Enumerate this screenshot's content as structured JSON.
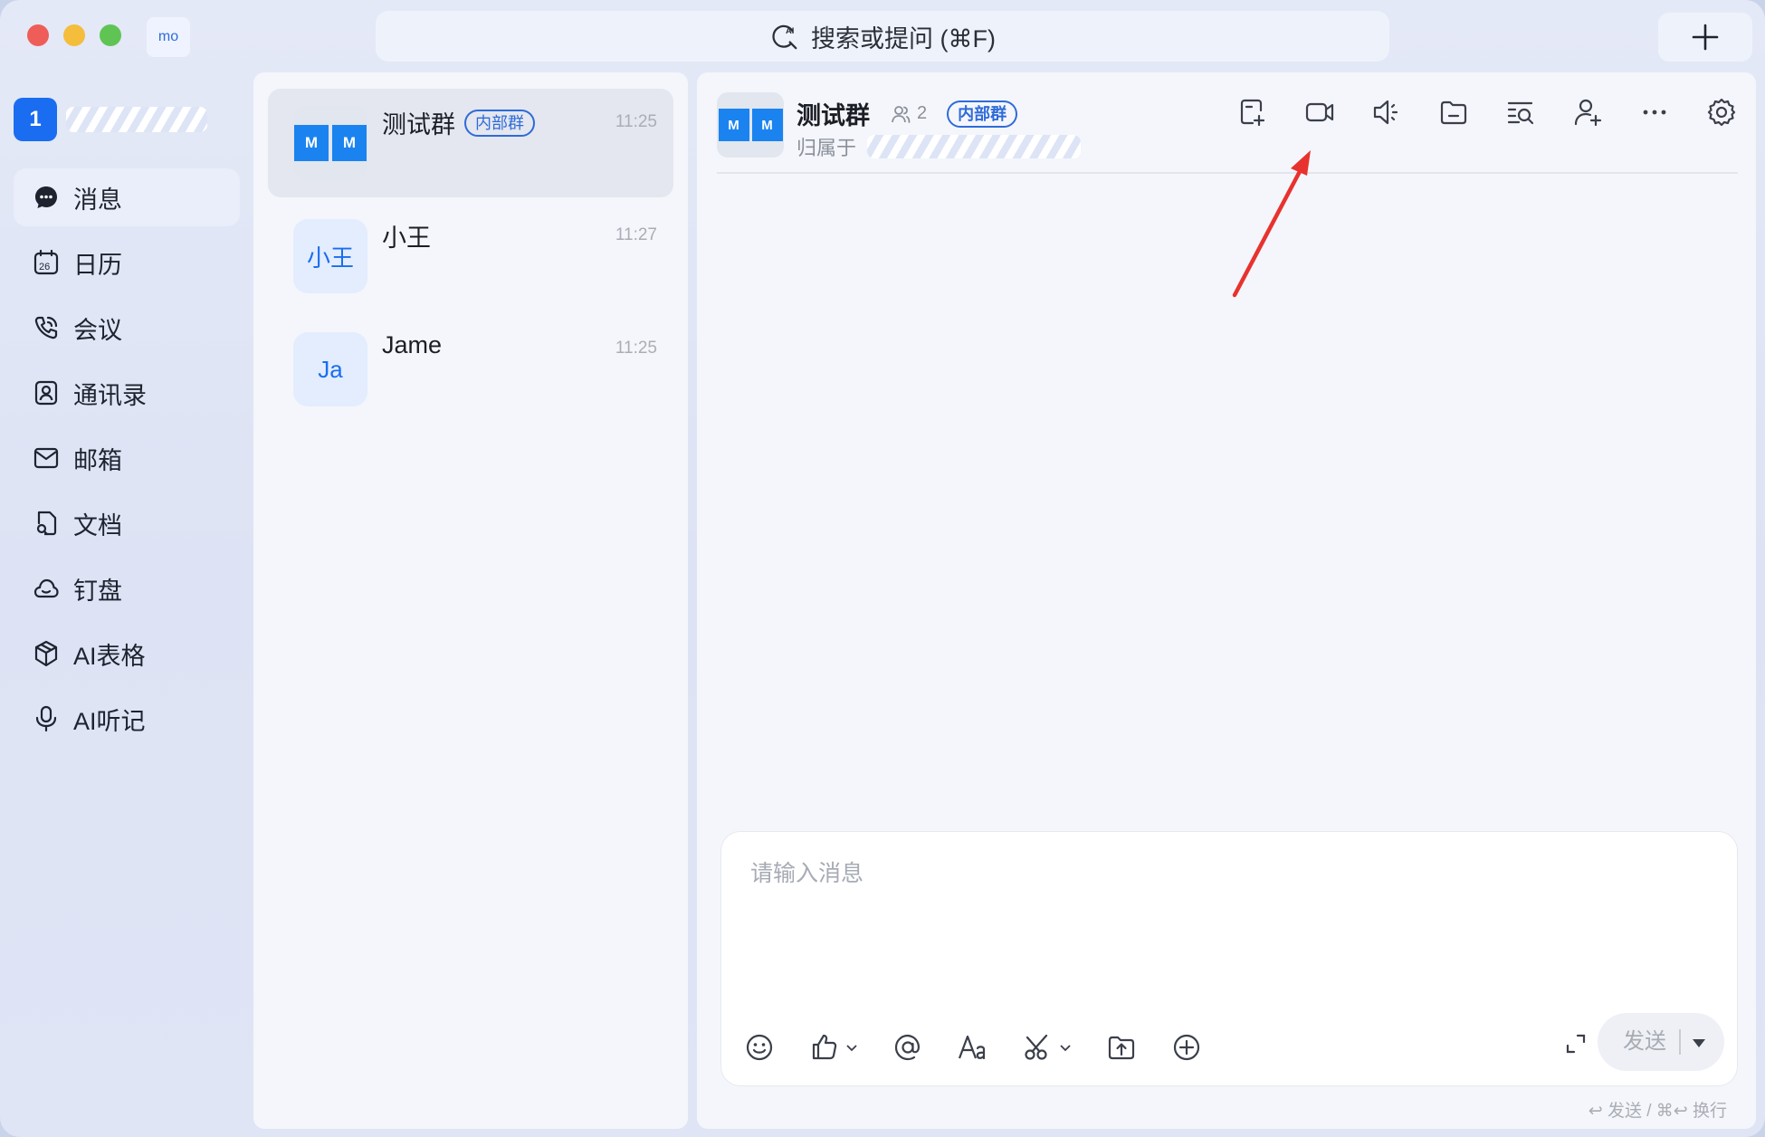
{
  "titlebar": {
    "workspace_badge": "mo",
    "search_placeholder": "搜索或提问 (⌘F)"
  },
  "profile": {
    "avatar_text": "1"
  },
  "nav": {
    "items": [
      {
        "label": "消息",
        "icon": "message-icon"
      },
      {
        "label": "日历",
        "icon": "calendar-icon"
      },
      {
        "label": "会议",
        "icon": "phone-call-icon"
      },
      {
        "label": "通讯录",
        "icon": "contacts-icon"
      },
      {
        "label": "邮箱",
        "icon": "mail-icon"
      },
      {
        "label": "文档",
        "icon": "document-icon"
      },
      {
        "label": "钉盘",
        "icon": "cloud-icon"
      },
      {
        "label": "AI表格",
        "icon": "cube-icon"
      },
      {
        "label": "AI听记",
        "icon": "microphone-icon"
      }
    ]
  },
  "conversations": [
    {
      "name": "测试群",
      "tag": "内部群",
      "time": "11:25",
      "avatar": "M",
      "avatar2": "M"
    },
    {
      "name": "小王",
      "time": "11:27",
      "avatar": "小王"
    },
    {
      "name": "Jame",
      "time": "11:25",
      "avatar": "Ja"
    }
  ],
  "chat": {
    "title": "测试群",
    "member_count": "2",
    "tag": "内部群",
    "subtitle_prefix": "归属于",
    "avatar": "M",
    "avatar2": "M"
  },
  "composer": {
    "placeholder": "请输入消息",
    "send_label": "发送",
    "hint": "↩ 发送 / ⌘↩ 换行"
  },
  "colors": {
    "accent": "#1a6df0",
    "arrow": "#e8322e"
  }
}
